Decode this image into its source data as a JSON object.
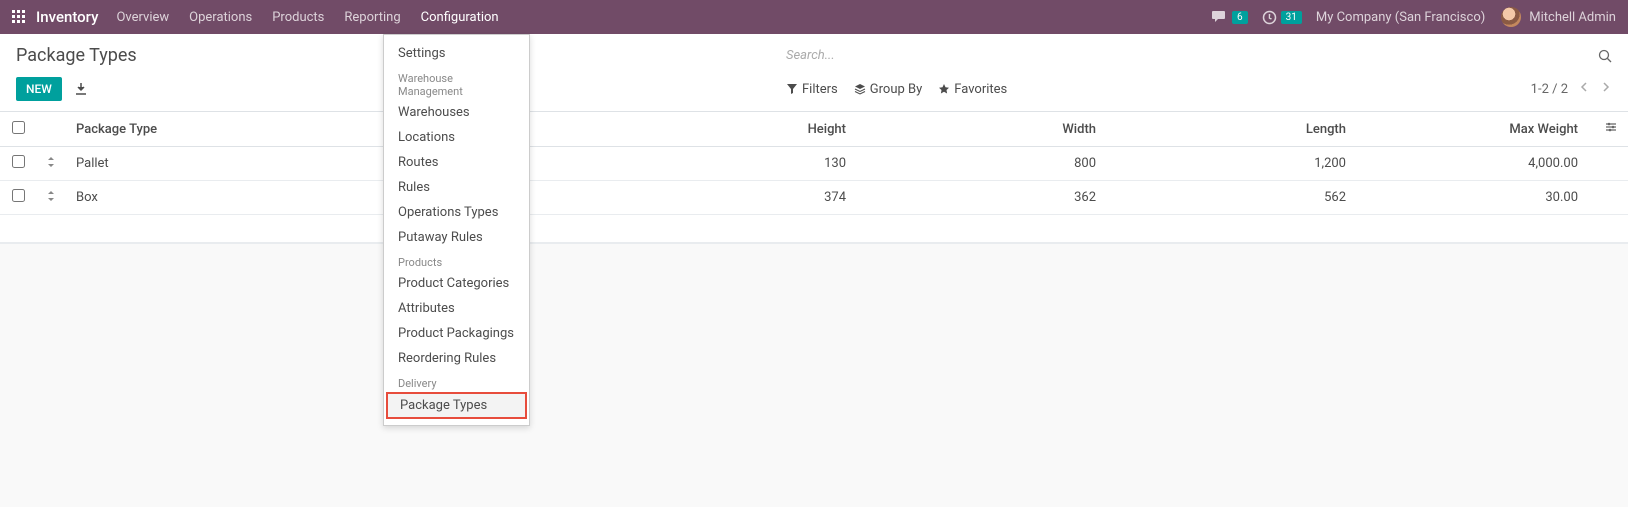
{
  "navbar": {
    "app": "Inventory",
    "items": [
      "Overview",
      "Operations",
      "Products",
      "Reporting",
      "Configuration"
    ],
    "messages_badge": "6",
    "activities_badge": "31",
    "company": "My Company (San Francisco)",
    "user": "Mitchell Admin"
  },
  "page": {
    "title": "Package Types",
    "new_button": "NEW",
    "search_placeholder": "Search...",
    "filters_label": "Filters",
    "groupby_label": "Group By",
    "favorites_label": "Favorites",
    "pager": "1-2 / 2"
  },
  "dropdown": {
    "settings": "Settings",
    "wm_header": "Warehouse Management",
    "wm_items": [
      "Warehouses",
      "Locations",
      "Routes",
      "Rules",
      "Operations Types",
      "Putaway Rules"
    ],
    "products_header": "Products",
    "products_items": [
      "Product Categories",
      "Attributes",
      "Product Packagings",
      "Reordering Rules"
    ],
    "delivery_header": "Delivery",
    "delivery_items": [
      "Package Types"
    ]
  },
  "table": {
    "headers": {
      "name": "Package Type",
      "height": "Height",
      "width": "Width",
      "length": "Length",
      "max_weight": "Max Weight"
    },
    "rows": [
      {
        "name": "Pallet",
        "height": "130",
        "width": "800",
        "length": "1,200",
        "max_weight": "4,000.00"
      },
      {
        "name": "Box",
        "height": "374",
        "width": "362",
        "length": "562",
        "max_weight": "30.00"
      }
    ]
  }
}
